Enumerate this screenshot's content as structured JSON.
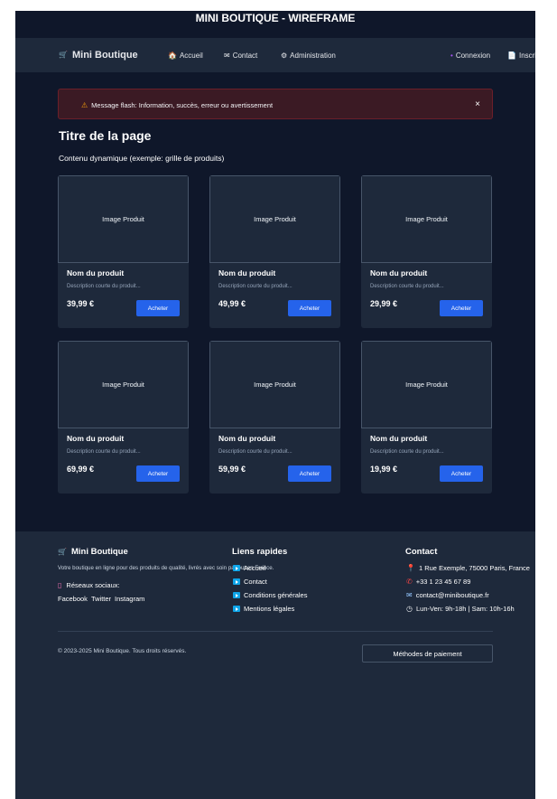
{
  "banner": {
    "title": "MINI BOUTIQUE - WIREFRAME"
  },
  "nav": {
    "brand": "Mini Boutique",
    "links": [
      "Accueil",
      "Contact",
      "Administration"
    ],
    "auth": [
      "Connexion",
      "Inscription"
    ]
  },
  "flash": {
    "message": "Message flash: Information, succès, erreur ou avertissement",
    "close": "×"
  },
  "page": {
    "title": "Titre de la page",
    "subtitle": "Contenu dynamique (exemple: grille de produits)"
  },
  "products": [
    {
      "image": "Image Produit",
      "name": "Nom du produit",
      "desc": "Description courte du produit...",
      "price": "39,99 €",
      "button": "Acheter"
    },
    {
      "image": "Image Produit",
      "name": "Nom du produit",
      "desc": "Description courte du produit...",
      "price": "49,99 €",
      "button": "Acheter"
    },
    {
      "image": "Image Produit",
      "name": "Nom du produit",
      "desc": "Description courte du produit...",
      "price": "29,99 €",
      "button": "Acheter"
    },
    {
      "image": "Image Produit",
      "name": "Nom du produit",
      "desc": "Description courte du produit...",
      "price": "69,99 €",
      "button": "Acheter"
    },
    {
      "image": "Image Produit",
      "name": "Nom du produit",
      "desc": "Description courte du produit...",
      "price": "59,99 €",
      "button": "Acheter"
    },
    {
      "image": "Image Produit",
      "name": "Nom du produit",
      "desc": "Description courte du produit...",
      "price": "19,99 €",
      "button": "Acheter"
    }
  ],
  "footer": {
    "brand": "Mini Boutique",
    "description": "Votre boutique en ligne pour des produits de qualité, livrés avec soin partout en France.",
    "social_title": "Réseaux sociaux:",
    "social_links": [
      "Facebook",
      "Twitter",
      "Instagram"
    ],
    "links_title": "Liens rapides",
    "links": [
      "Accueil",
      "Contact",
      "Conditions générales",
      "Mentions légales"
    ],
    "contact_title": "Contact",
    "contact": [
      "1 Rue Exemple, 75000 Paris, France",
      "+33 1 23 45 67 89",
      "contact@miniboutique.fr",
      "Lun-Ven: 9h-18h | Sam: 10h-16h"
    ],
    "copyright": "© 2023-2025 Mini Boutique. Tous droits réservés.",
    "payment_button": "Méthodes de paiement"
  },
  "icons": {
    "brand": "cart-icon",
    "home": "house-icon",
    "contact": "envelope-icon",
    "admin": "gear-icon",
    "login": "person-icon",
    "signup": "document-icon",
    "warning": "warning-icon",
    "social": "phone-device-icon"
  }
}
